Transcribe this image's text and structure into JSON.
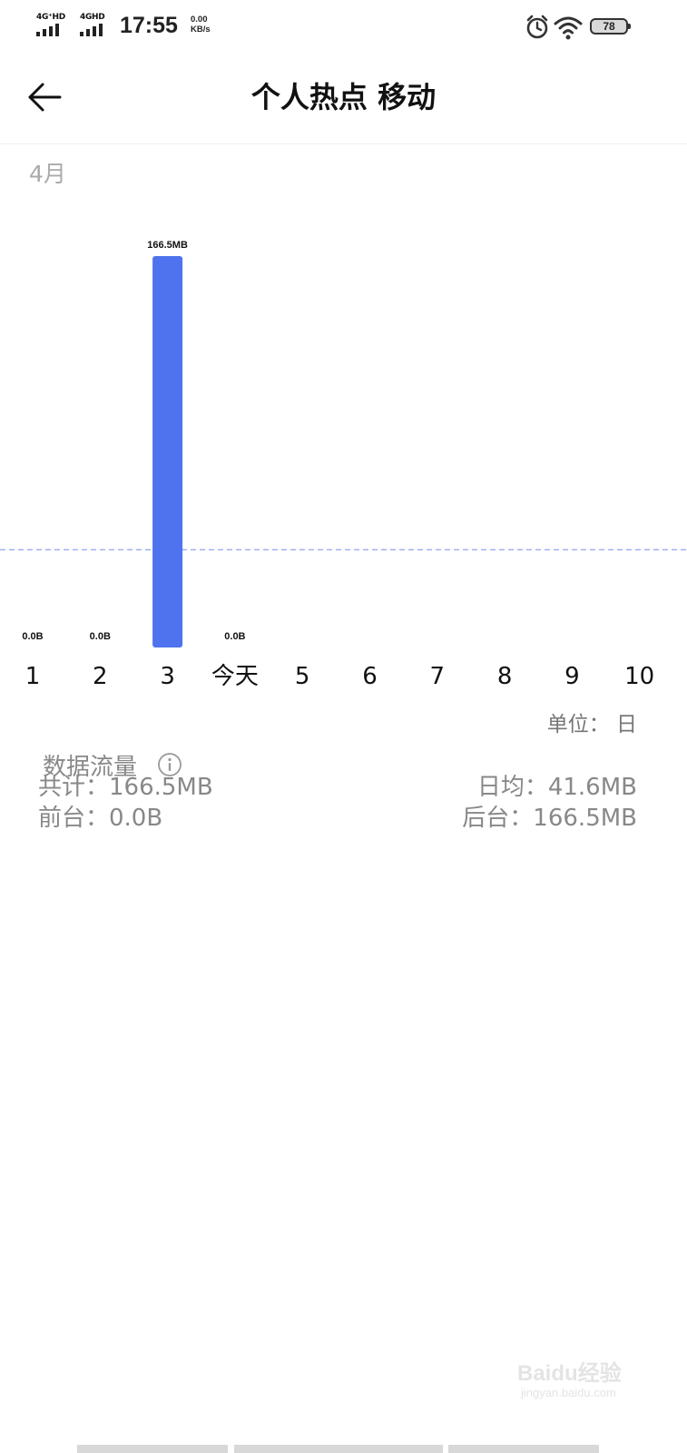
{
  "status_bar": {
    "sim1_network": "4G⁺HD",
    "sim2_network": "4GHD",
    "time": "17:55",
    "speed_value": "0.00",
    "speed_unit": "KB/s",
    "battery": "78",
    "icons": [
      "signal-icon",
      "signal-icon",
      "alarm-icon",
      "wifi-icon",
      "battery-icon"
    ]
  },
  "header": {
    "title": "个人热点 移动",
    "back_icon": "back-arrow-icon"
  },
  "chart": {
    "month": "4月",
    "unit_label": "单位： 日"
  },
  "chart_data": {
    "type": "bar",
    "categories": [
      "1",
      "2",
      "3",
      "今天",
      "5",
      "6",
      "7",
      "8",
      "9",
      "10"
    ],
    "values": [
      0,
      0,
      166.5,
      0,
      null,
      null,
      null,
      null,
      null,
      null
    ],
    "data_labels": [
      "0.0B",
      "0.0B",
      "166.5MB",
      "0.0B",
      "",
      "",
      "",
      "",
      "",
      ""
    ],
    "value_unit": "MB",
    "average_line": 41.6,
    "ylim": [
      0,
      166.5
    ],
    "bar_color": "#4f73ee",
    "average_line_color": "#9fb0ef",
    "grid": false,
    "legend": "none"
  },
  "summary": {
    "title": "数据流量",
    "info_icon": "info-icon",
    "total": "共计：166.5MB",
    "daily_avg": "日均：41.6MB",
    "foreground": "前台：0.0B",
    "background": "后台：166.5MB"
  },
  "watermark": {
    "brand": "Baidu经验",
    "site": "jingyan.baidu.com"
  },
  "colors": {
    "accent": "#4f73ee",
    "muted_text": "#888888",
    "title_text": "#111111"
  }
}
